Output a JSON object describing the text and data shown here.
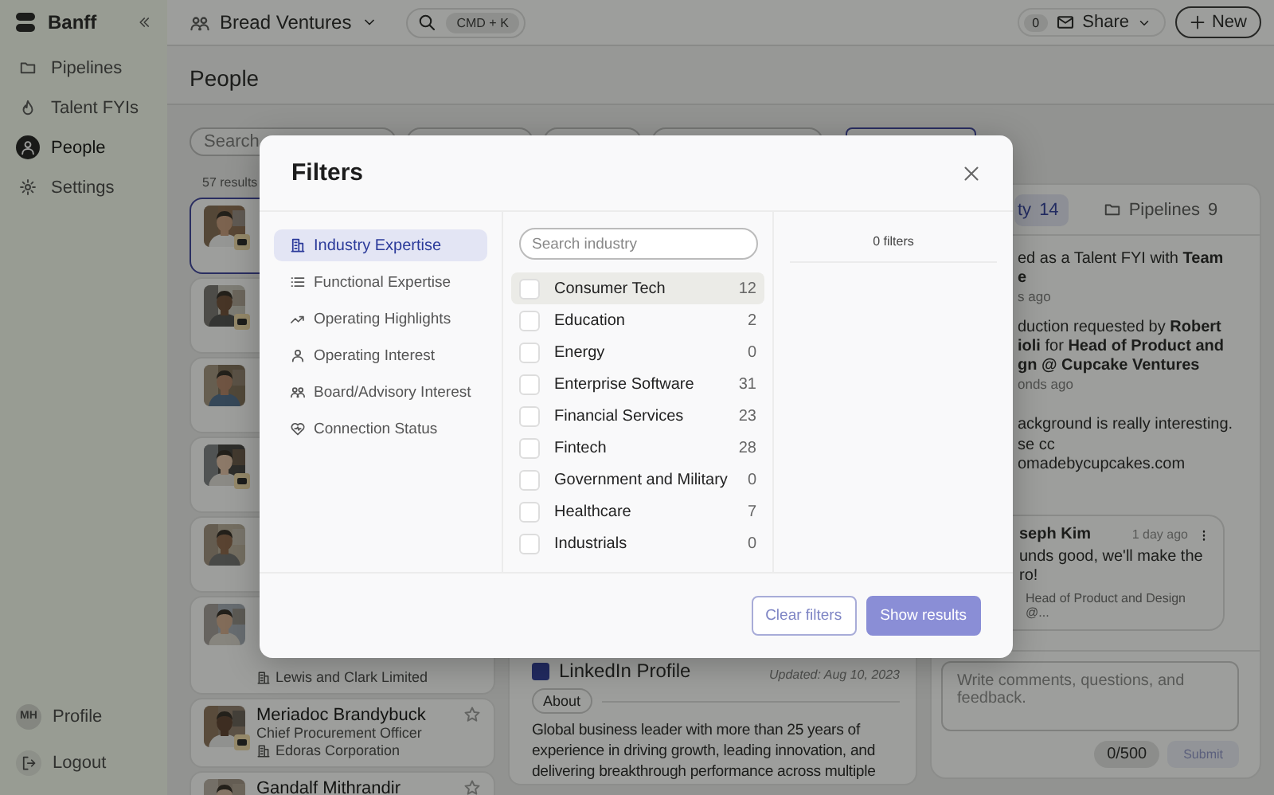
{
  "app": {
    "name": "Banff"
  },
  "sidebar": {
    "items": [
      {
        "label": "Pipelines",
        "selected": false
      },
      {
        "label": "Talent FYIs",
        "selected": false
      },
      {
        "label": "People",
        "selected": true
      },
      {
        "label": "Settings",
        "selected": false
      }
    ],
    "profile": {
      "initials": "MH",
      "label": "Profile"
    },
    "logout": "Logout"
  },
  "topbar": {
    "workspace": "Bread Ventures",
    "search_shortcut": "CMD + K",
    "share_count": "0",
    "share": "Share",
    "new": "New"
  },
  "page": {
    "title": "People",
    "search": {
      "placeholder": "Search"
    },
    "results": "57 results"
  },
  "people": [
    {
      "badge": true,
      "selected": true
    },
    {
      "badge": true,
      "selected": false
    },
    {
      "badge": false,
      "selected": false
    },
    {
      "badge": true,
      "selected": false
    },
    {
      "badge": false,
      "selected": false
    },
    {
      "company": "Lewis and Clark Limited",
      "badge": false,
      "selected": false
    },
    {
      "lines": [
        "Meriadoc Brandybuck",
        "Chief Procurement Officer"
      ],
      "company": "Edoras Corporation",
      "badge": true,
      "starred": false,
      "selected": false
    },
    {
      "lines": [
        "Gandalf Mithrandir"
      ],
      "badge": false,
      "starred": false,
      "selected": false
    }
  ],
  "profile_detail": {
    "section": "LinkedIn Profile",
    "updated": "Updated: Aug 10, 2023",
    "about_label": "About",
    "about": "Global business leader with more than 25 years of experience in driving growth, leading innovation, and delivering breakthrough performance across multiple"
  },
  "activity": {
    "tabs": [
      {
        "label": "ty",
        "count": "14",
        "selected": true
      },
      {
        "label": "Pipelines",
        "count": "9",
        "selected": false
      }
    ],
    "events": [
      {
        "text": "ed as a Talent FYI with **Team**\n**e**",
        "time": "s ago"
      },
      {
        "text": "duction requested by **Robert**\n**ioli** for **Head of Product and**\n**gn @ Cupcake Ventures**",
        "time": "onds ago"
      }
    ],
    "note": "ackground is really interesting.\nse cc\nomadebycupcakes.com",
    "comment": {
      "author": "seph Kim",
      "time": "1 day ago",
      "text": "unds good, we'll make the\nro!",
      "context": "Head of Product and Design @..."
    },
    "composer": {
      "placeholder": "Write comments, questions, and feedback.",
      "counter": "0/500",
      "submit": "Submit"
    }
  },
  "filters": {
    "title": "Filters",
    "categories": [
      {
        "label": "Industry Expertise",
        "selected": true
      },
      {
        "label": "Functional Expertise",
        "selected": false
      },
      {
        "label": "Operating Highlights",
        "selected": false
      },
      {
        "label": "Operating Interest",
        "selected": false
      },
      {
        "label": "Board/Advisory Interest",
        "selected": false
      },
      {
        "label": "Connection Status",
        "selected": false
      }
    ],
    "search": {
      "placeholder": "Search industry"
    },
    "options": [
      {
        "label": "Consumer Tech",
        "count": "12",
        "checked": false,
        "hovered": true
      },
      {
        "label": "Education",
        "count": "2",
        "checked": false,
        "hovered": false
      },
      {
        "label": "Energy",
        "count": "0",
        "checked": false,
        "hovered": false
      },
      {
        "label": "Enterprise Software",
        "count": "31",
        "checked": false,
        "hovered": false
      },
      {
        "label": "Financial Services",
        "count": "23",
        "checked": false,
        "hovered": false
      },
      {
        "label": "Fintech",
        "count": "28",
        "checked": false,
        "hovered": false
      },
      {
        "label": "Government and Military",
        "count": "0",
        "checked": false,
        "hovered": false
      },
      {
        "label": "Healthcare",
        "count": "7",
        "checked": false,
        "hovered": false
      },
      {
        "label": "Industrials",
        "count": "0",
        "checked": false,
        "hovered": false
      }
    ],
    "summary": "0 filters",
    "clear": "Clear filters",
    "show": "Show results"
  }
}
